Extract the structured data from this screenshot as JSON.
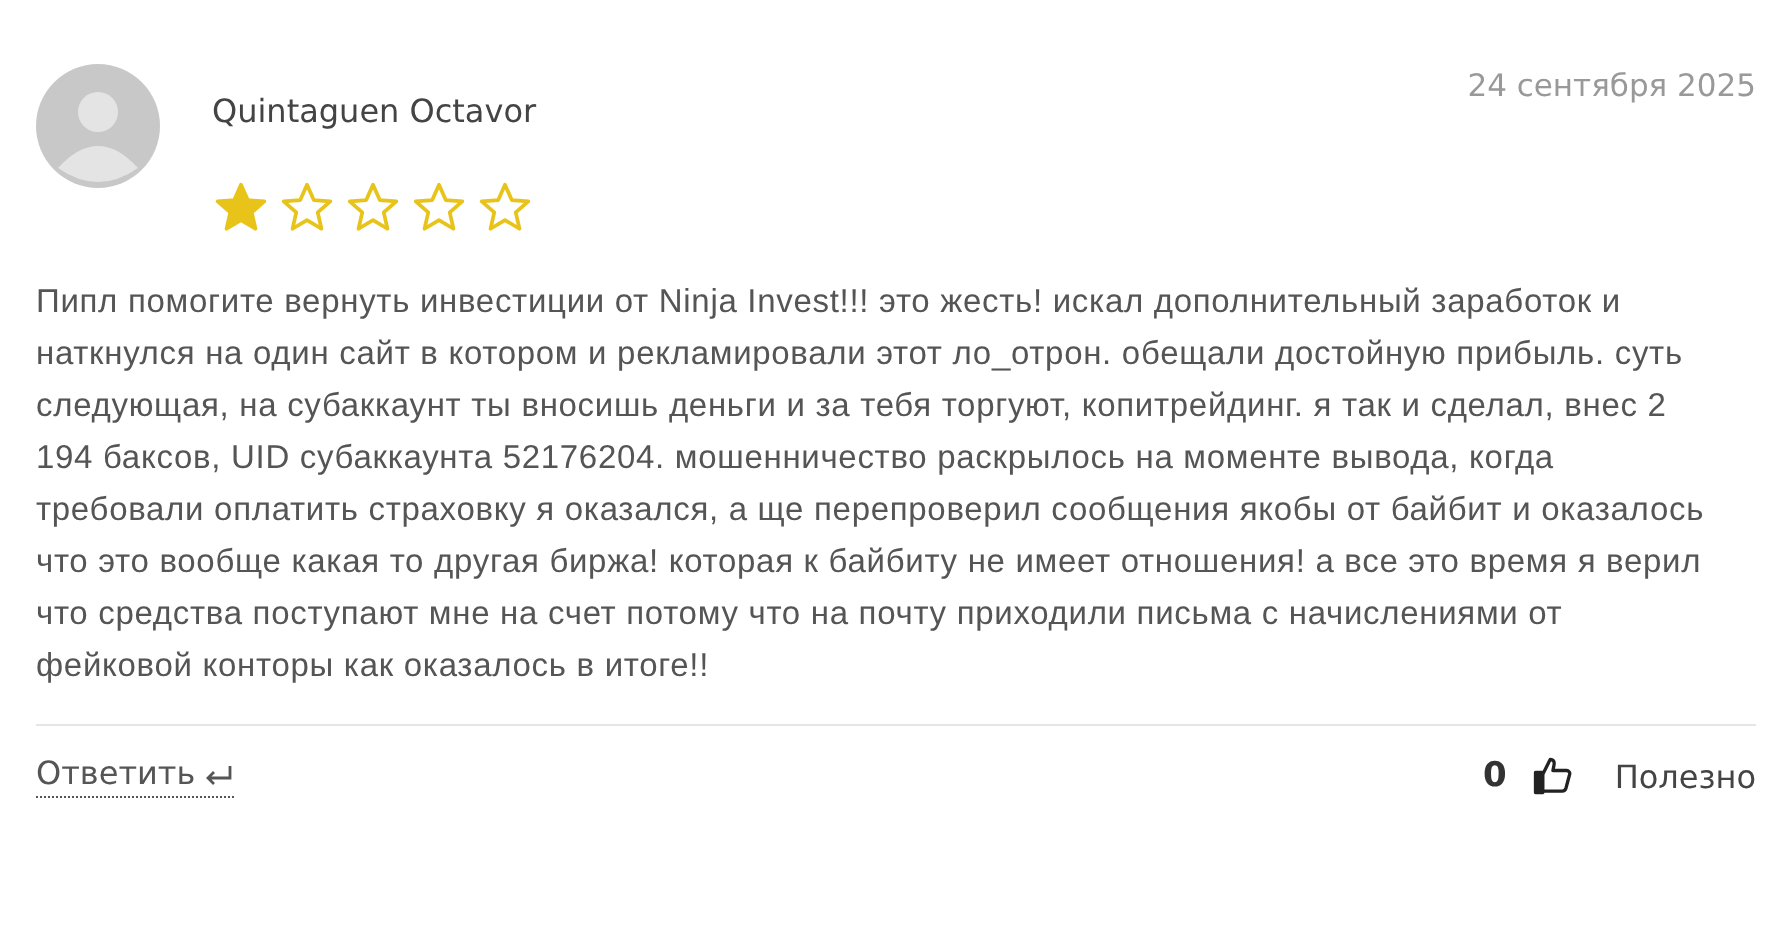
{
  "review": {
    "author": "Quintaguen Octavor",
    "date": "24 сентября 2025",
    "stars": 1,
    "text": "Пипл помогите вернуть инвестиции от Ninja Invest!!! это жесть! искал дополнительный заработок и наткнулся на один сайт в котором и рекламировали этот ло_отрон. обещали достойную прибыль. суть следующая, на субаккаунт ты вносишь деньги и за тебя торгуют, копитрейдинг. я так и сделал, внес 2 194 баксов, UID субаккаунта 52176204. мошенничество раскрылось на моменте вывода, когда требовали оплатить страховку я оказался, а ще перепроверил сообщения якобы от байбит и оказалось что это вообще какая то другая биржа! которая к байбиту не имеет отношения! а все это время я верил что средства поступают мне на счет потому что на почту приходили письма с начислениями от фейковой конторы как оказалось в итоге!!",
    "reply_label": "Ответить",
    "helpful_count": "0",
    "helpful_label": "Полезно"
  }
}
